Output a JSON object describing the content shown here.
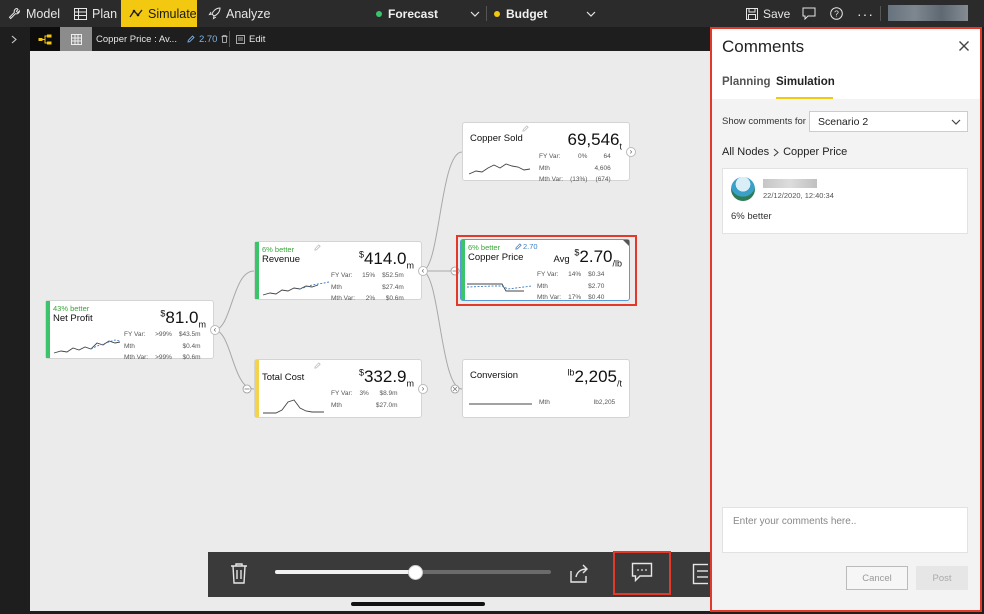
{
  "topbar": {
    "modes": [
      {
        "label": "Model",
        "icon": "wrench-icon"
      },
      {
        "label": "Plan",
        "icon": "table-icon"
      },
      {
        "label": "Simulate",
        "icon": "simulate-icon"
      },
      {
        "label": "Analyze",
        "icon": "rocket-icon"
      }
    ],
    "forecast_label": "Forecast",
    "budget_label": "Budget",
    "save_label": "Save",
    "colors": {
      "active": "#f2c811",
      "forecast_dot": "#3cc46b",
      "budget_dot": "#f2c811"
    }
  },
  "subbar": {
    "node_label": "Copper Price : Av...",
    "node_value": "2.70",
    "edit_label": "Edit"
  },
  "nodes": {
    "net_profit": {
      "tag": "43% better",
      "name": "Net Profit",
      "currency": "$",
      "value": "81.0",
      "unit": "m",
      "stats": [
        [
          "FY Var:",
          ">99%",
          "$43.5m"
        ],
        [
          "Mth",
          "",
          "$0.4m"
        ],
        [
          "Mth Var:",
          ">99%",
          "$0.6m"
        ]
      ]
    },
    "revenue": {
      "tag": "6% better",
      "name": "Revenue",
      "currency": "$",
      "value": "414.0",
      "unit": "m",
      "stats": [
        [
          "FY Var:",
          "15%",
          "$52.5m"
        ],
        [
          "Mth",
          "",
          "$27.4m"
        ],
        [
          "Mth Var:",
          "2%",
          "$0.6m"
        ]
      ]
    },
    "total_cost": {
      "name": "Total Cost",
      "currency": "$",
      "value": "332.9",
      "unit": "m",
      "stats": [
        [
          "FY Var:",
          "3%",
          "$8.9m"
        ],
        [
          "Mth",
          "",
          "$27.0m"
        ]
      ]
    },
    "copper_sold": {
      "name": "Copper Sold",
      "value": "69,546",
      "unit": "t",
      "stats": [
        [
          "FY Var:",
          "0%",
          "64"
        ],
        [
          "Mth",
          "",
          "4,606"
        ],
        [
          "Mth Var:",
          "(13%)",
          "(674)"
        ]
      ]
    },
    "copper_price": {
      "tag": "6% better",
      "edit_value": "2.70",
      "name": "Copper Price",
      "prefix": "Avg",
      "currency": "$",
      "value": "2.70",
      "unit": "/lb",
      "stats": [
        [
          "FY Var:",
          "14%",
          "$0.34"
        ],
        [
          "Mth",
          "",
          "$2.70"
        ],
        [
          "Mth Var:",
          "17%",
          "$0.40"
        ]
      ]
    },
    "conversion": {
      "name": "Conversion",
      "currency": "lb",
      "value": "2,205",
      "unit": "/t",
      "stats": [
        [
          "Mth",
          "",
          "lb2,205"
        ]
      ]
    }
  },
  "comments": {
    "title": "Comments",
    "tabs": [
      "Planning",
      "Simulation"
    ],
    "active_tab": "Simulation",
    "show_comments_label": "Show comments for",
    "scenario_value": "Scenario 2",
    "breadcrumb_root": "All Nodes",
    "breadcrumb_current": "Copper Price",
    "items": [
      {
        "timestamp": "22/12/2020, 12:40:34",
        "text": "6% better"
      }
    ],
    "input_placeholder": "Enter your comments here..",
    "cancel_label": "Cancel",
    "post_label": "Post"
  },
  "slider": {
    "fraction": 0.83
  },
  "accent": {
    "highlight": "#e3392b",
    "green": "#3aa53a",
    "yellow": "#f2d34b",
    "blue": "#5b9bd5"
  }
}
